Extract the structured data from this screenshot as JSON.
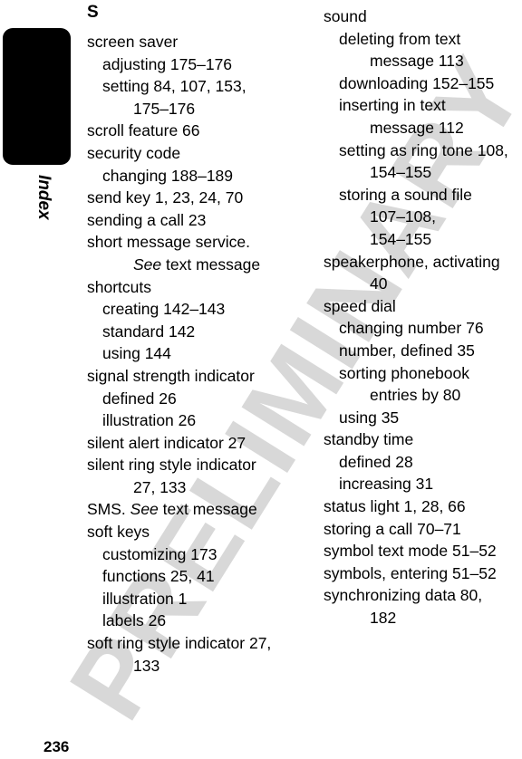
{
  "page": {
    "number": "236",
    "tab_label": "Index",
    "watermark": "PRELIMINARY",
    "watermark_color": "#d8d8d8",
    "background_color": "#ffffff",
    "text_color": "#000000",
    "tab_color": "#000000"
  },
  "left_column": {
    "section_letter": "S",
    "entries": [
      {
        "level": 0,
        "text": "screen saver"
      },
      {
        "level": 1,
        "text": "adjusting  175–176"
      },
      {
        "level": 1,
        "text": "setting  84, 107, 153,"
      },
      {
        "level": 2,
        "text": "175–176"
      },
      {
        "level": 0,
        "text": "scroll feature  66"
      },
      {
        "level": 0,
        "text": "security code"
      },
      {
        "level": 1,
        "text": "changing  188–189"
      },
      {
        "level": 0,
        "text": "send key  1, 23, 24, 70"
      },
      {
        "level": 0,
        "text": "sending a call  23"
      },
      {
        "level": 0,
        "text": "short message service."
      },
      {
        "level": 2,
        "text": "See text message",
        "italic_prefix": "See"
      },
      {
        "level": 0,
        "text": "shortcuts"
      },
      {
        "level": 1,
        "text": "creating  142–143"
      },
      {
        "level": 1,
        "text": "standard  142"
      },
      {
        "level": 1,
        "text": "using  144"
      },
      {
        "level": 0,
        "text": "signal strength indicator"
      },
      {
        "level": 1,
        "text": "defined  26"
      },
      {
        "level": 1,
        "text": "illustration  26"
      },
      {
        "level": 0,
        "text": "silent alert indicator  27"
      },
      {
        "level": 0,
        "text": "silent ring style indicator"
      },
      {
        "level": 2,
        "text": "27, 133"
      },
      {
        "level": 0,
        "text": "SMS. See text message",
        "italic_mid": "See"
      },
      {
        "level": 0,
        "text": "soft keys"
      },
      {
        "level": 1,
        "text": "customizing  173"
      },
      {
        "level": 1,
        "text": "functions  25, 41"
      },
      {
        "level": 1,
        "text": "illustration  1"
      },
      {
        "level": 1,
        "text": "labels  26"
      },
      {
        "level": 0,
        "text": "soft ring style indicator  27,"
      },
      {
        "level": 2,
        "text": "133"
      }
    ]
  },
  "right_column": {
    "entries": [
      {
        "level": 0,
        "text": "sound"
      },
      {
        "level": 1,
        "text": "deleting from text"
      },
      {
        "level": 2,
        "text": "message  113"
      },
      {
        "level": 1,
        "text": "downloading  152–155"
      },
      {
        "level": 1,
        "text": "inserting in text"
      },
      {
        "level": 2,
        "text": "message  112"
      },
      {
        "level": 1,
        "text": "setting as ring tone  108,"
      },
      {
        "level": 2,
        "text": "154–155"
      },
      {
        "level": 1,
        "text": "storing a sound file"
      },
      {
        "level": 2,
        "text": "107–108,"
      },
      {
        "level": 2,
        "text": "154–155"
      },
      {
        "level": 0,
        "text": "speakerphone, activating"
      },
      {
        "level": 2,
        "text": "40"
      },
      {
        "level": 0,
        "text": "speed dial"
      },
      {
        "level": 1,
        "text": "changing number  76"
      },
      {
        "level": 1,
        "text": "number, defined  35"
      },
      {
        "level": 1,
        "text": "sorting phonebook"
      },
      {
        "level": 2,
        "text": "entries by  80"
      },
      {
        "level": 1,
        "text": "using  35"
      },
      {
        "level": 0,
        "text": "standby time"
      },
      {
        "level": 1,
        "text": "defined  28"
      },
      {
        "level": 1,
        "text": "increasing  31"
      },
      {
        "level": 0,
        "text": "status light  1, 28, 66"
      },
      {
        "level": 0,
        "text": "storing a call  70–71"
      },
      {
        "level": 0,
        "text": "symbol text mode  51–52"
      },
      {
        "level": 0,
        "text": "symbols, entering  51–52"
      },
      {
        "level": 0,
        "text": "synchronizing data  80,"
      },
      {
        "level": 2,
        "text": "182"
      }
    ]
  }
}
